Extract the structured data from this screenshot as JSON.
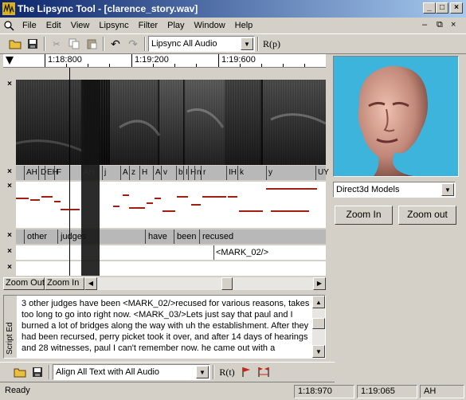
{
  "window": {
    "title": "The Lipsync Tool - [clarence_story.wav]"
  },
  "menu": [
    "File",
    "Edit",
    "View",
    "Lipsync",
    "Filter",
    "Play",
    "Window",
    "Help"
  ],
  "toolbar": {
    "audio_combo": "Lipsync All Audio",
    "render_label": "R(p)"
  },
  "ruler": {
    "labels": [
      "1:18:800",
      "1:19:200",
      "1:19:600"
    ]
  },
  "phonemes": [
    "AH",
    "D",
    "EH",
    "F",
    "AH",
    "j",
    "A",
    "z",
    "H",
    "A",
    "v",
    "b",
    "I",
    "H",
    "n",
    "r",
    "IH",
    "k",
    "y",
    "UY"
  ],
  "words": [
    "other",
    "judges",
    "have",
    "been",
    "recused"
  ],
  "mark": "<MARK_02/>",
  "zoom": {
    "out": "Zoom Out",
    "in": "Zoom In"
  },
  "right_panel": {
    "model_combo": "Direct3d Models",
    "zoom_in": "Zoom In",
    "zoom_out": "Zoom out"
  },
  "script": {
    "tab_label": "Script Ed",
    "text": "3 other judges have been <MARK_02/>recused for various reasons, takes too long to go into right now. <MARK_03/>Lets just say that paul and I burned a lot of bridges along the way with uh the establishment. After they had been recursed, perry picket took it over, and after 14 days of hearings and 28 witnesses, paul I can't remember now. he came out with a"
  },
  "bottom_toolbar": {
    "align_combo": "Align All Text with All Audio",
    "render_label": "R(t)"
  },
  "status": {
    "ready": "Ready",
    "time1": "1:18:970",
    "time2": "1:19:065",
    "phoneme": "AH"
  }
}
